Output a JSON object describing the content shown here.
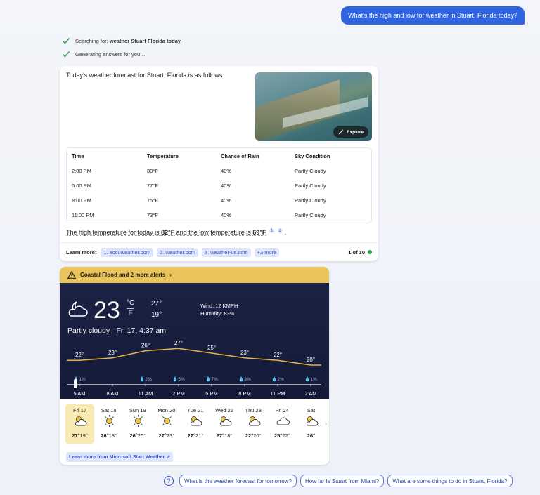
{
  "user_message": "What's the high and low for weather in Stuart, Florida today?",
  "status": {
    "searching_prefix": "Searching for: ",
    "searching_query": "weather Stuart Florida today",
    "generating": "Generating answers for you…"
  },
  "answer": {
    "intro": "Today's weather forecast for Stuart, Florida is as follows:",
    "explore_label": "Explore",
    "table": {
      "headers": [
        "Time",
        "Temperature",
        "Chance of Rain",
        "Sky Condition"
      ],
      "rows": [
        [
          "2:00 PM",
          "80°F",
          "40%",
          "Partly Cloudy"
        ],
        [
          "5:00 PM",
          "77°F",
          "40%",
          "Partly Cloudy"
        ],
        [
          "8:00 PM",
          "75°F",
          "40%",
          "Partly Cloudy"
        ],
        [
          "11:00 PM",
          "73°F",
          "40%",
          "Partly Cloudy"
        ]
      ]
    },
    "summary_a": "The high temperature for today is ",
    "summary_high": "82°F",
    "summary_b": " and the low temperature is ",
    "summary_low": "69°F",
    "summary_end": ".",
    "cite1": "1",
    "cite2": "2",
    "learn_more_label": "Learn more:",
    "sources": [
      "1. accuweather.com",
      "2. weather.com",
      "3. weather-us.com",
      "+3 more"
    ],
    "pager": "1 of 10"
  },
  "weather": {
    "alert": "Coastal Flood and 2 more alerts",
    "temp": "23",
    "unit_c": "°C",
    "unit_f": "F",
    "high": "27°",
    "low": "19°",
    "wind": "Wind: 12 KMPH",
    "humidity": "Humidity: 83%",
    "condition": "Partly cloudy · Fri 17, 4:37 am",
    "hourly": {
      "times": [
        "5 AM",
        "8 AM",
        "11 AM",
        "2 PM",
        "5 PM",
        "8 PM",
        "11 PM",
        "2 AM"
      ],
      "temps": [
        "22°",
        "23°",
        "26°",
        "27°",
        "25°",
        "23°",
        "22°",
        "20°"
      ],
      "temp_values": [
        22,
        23,
        26,
        27,
        25,
        23,
        22,
        20
      ],
      "rain": [
        "1%",
        "",
        "2%",
        "5%",
        "7%",
        "3%",
        "2%",
        "1%"
      ]
    },
    "days": [
      {
        "name": "Fri 17",
        "hi": "27°",
        "lo": "19°",
        "icon": "partly-cloudy-icon"
      },
      {
        "name": "Sat 18",
        "hi": "26°",
        "lo": "18°",
        "icon": "sun-icon"
      },
      {
        "name": "Sun 19",
        "hi": "26°",
        "lo": "20°",
        "icon": "sun-icon"
      },
      {
        "name": "Mon 20",
        "hi": "27°",
        "lo": "23°",
        "icon": "sun-icon"
      },
      {
        "name": "Tue 21",
        "hi": "27°",
        "lo": "21°",
        "icon": "partly-cloudy-icon"
      },
      {
        "name": "Wed 22",
        "hi": "27°",
        "lo": "18°",
        "icon": "partly-cloudy-icon"
      },
      {
        "name": "Thu 23",
        "hi": "22°",
        "lo": "20°",
        "icon": "partly-cloudy-icon"
      },
      {
        "name": "Fri 24",
        "hi": "25°",
        "lo": "22°",
        "icon": "cloud-icon"
      },
      {
        "name": "Sat",
        "hi": "26°",
        "lo": "",
        "icon": "partly-cloudy-icon"
      }
    ],
    "ms_link": "Learn more from Microsoft Start Weather"
  },
  "suggestions": [
    "What is the weather forecast for tomorrow?",
    "How far is Stuart from Miami?",
    "What are some things to do in Stuart, Florida?"
  ],
  "colors": {
    "accent": "#2f63e0",
    "alert": "#e9c45a",
    "panel": "#1c2244",
    "curve": "#e8b54a"
  }
}
